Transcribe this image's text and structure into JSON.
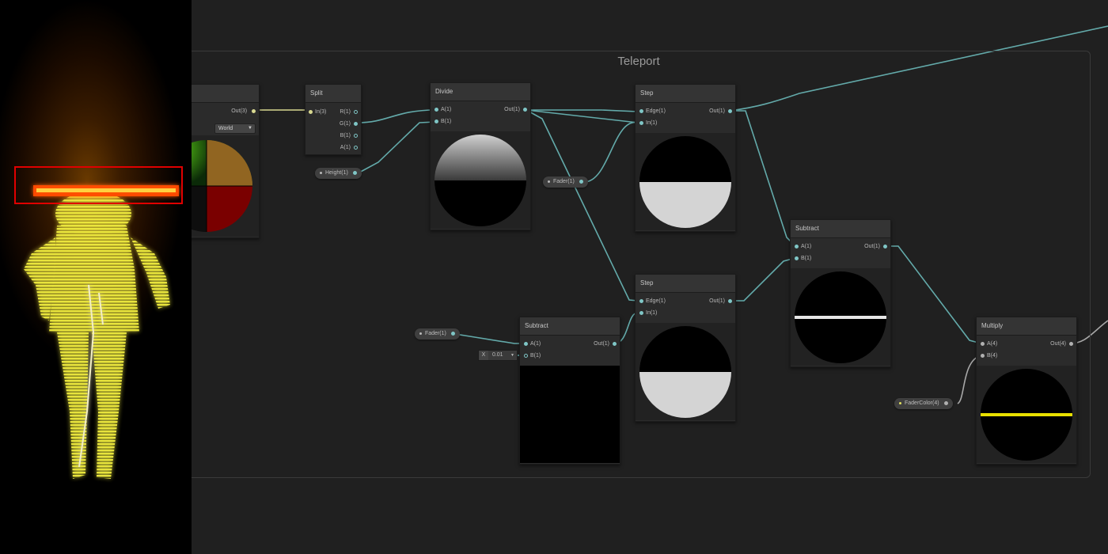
{
  "graph": {
    "group_title": "Teleport"
  },
  "nodes": {
    "position": {
      "out_label": "Out(3)",
      "space_option": "World"
    },
    "split": {
      "title": "Split",
      "in_label": "In(3)",
      "outs": [
        "R(1)",
        "G(1)",
        "B(1)",
        "A(1)"
      ]
    },
    "divide": {
      "title": "Divide",
      "a_label": "A(1)",
      "b_label": "B(1)",
      "out_label": "Out(1)"
    },
    "step1": {
      "title": "Step",
      "edge_label": "Edge(1)",
      "in_label": "In(1)",
      "out_label": "Out(1)"
    },
    "step2": {
      "title": "Step",
      "edge_label": "Edge(1)",
      "in_label": "In(1)",
      "out_label": "Out(1)"
    },
    "subtract_small": {
      "title": "Subtract",
      "a_label": "A(1)",
      "b_label": "B(1)",
      "out_label": "Out(1)",
      "x_label": "X",
      "x_value": "0.01"
    },
    "subtract_big": {
      "title": "Subtract",
      "a_label": "A(1)",
      "b_label": "B(1)",
      "out_label": "Out(1)"
    },
    "multiply": {
      "title": "Multiply",
      "a_label": "A(4)",
      "b_label": "B(4)",
      "out_label": "Out(4)"
    }
  },
  "properties": {
    "height": "Height(1)",
    "fader_top": "Fader(1)",
    "fader_bottom": "Fader(1)",
    "fader_color": "FaderColor(4)"
  },
  "colors": {
    "wire_float": "#63aaaa",
    "wire_vector": "#d8d890",
    "wire_color": "#a8a8a8",
    "highlight_box": "#e00000",
    "fader_line": "#e8e000"
  }
}
